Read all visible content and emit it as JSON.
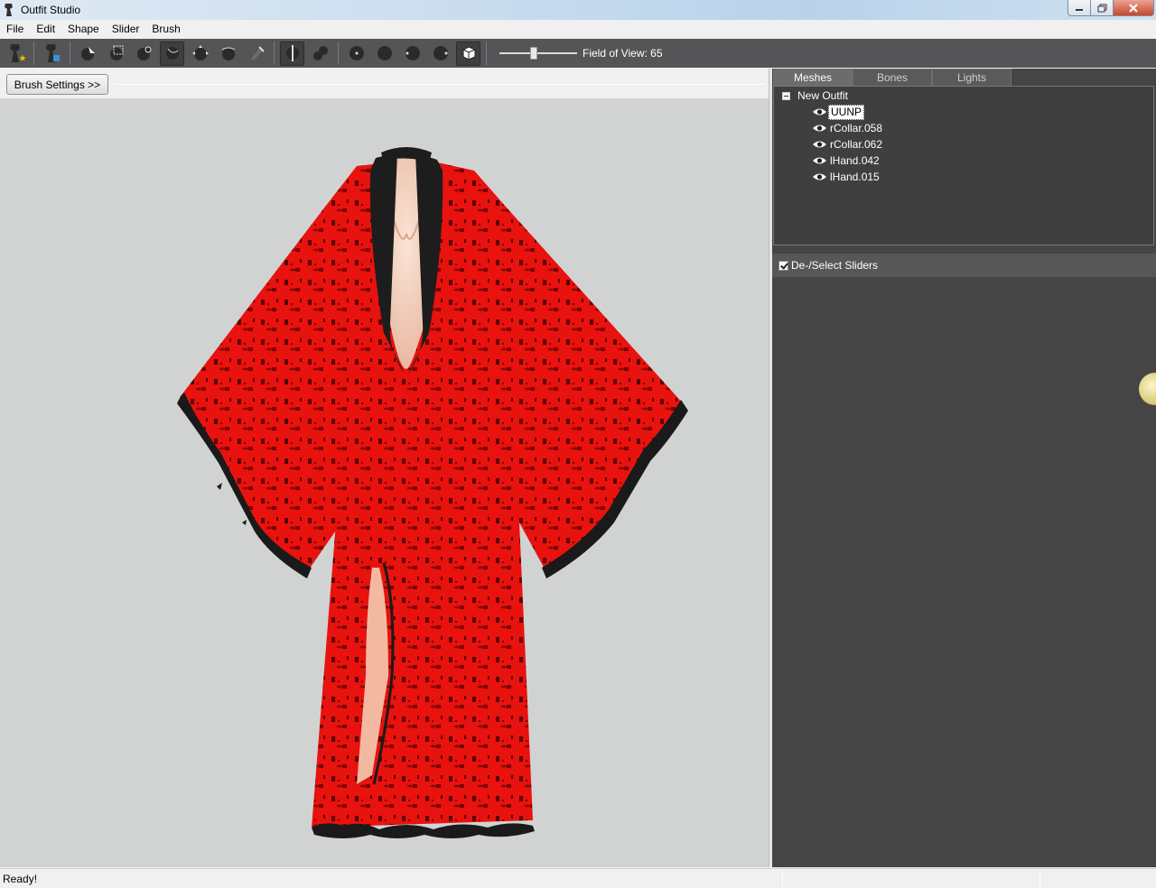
{
  "window": {
    "title": "Outfit Studio"
  },
  "menu": [
    "File",
    "Edit",
    "Shape",
    "Slider",
    "Brush"
  ],
  "toolbar": {
    "fov_label": "Field of View: 65",
    "icons": [
      "new-project-icon",
      "load-outfit-icon",
      "select-tool-icon",
      "mask-tool-icon",
      "inflate-tool-icon",
      "deflate-tool-icon",
      "move-tool-icon",
      "smooth-tool-icon",
      "weight-tool-icon",
      "x-mirror-icon",
      "connected-icon",
      "front-view-icon",
      "back-view-icon",
      "left-view-icon",
      "right-view-icon",
      "perspective-icon"
    ],
    "fov_fraction": 0.44
  },
  "brush": {
    "settings_label": "Brush Settings >>"
  },
  "panel": {
    "tabs": [
      "Meshes",
      "Bones",
      "Lights"
    ],
    "active_tab": "Meshes",
    "tree": {
      "root": "New Outfit",
      "items": [
        "UUNP",
        "rCollar.058",
        "rCollar.062",
        "lHand.042",
        "lHand.015"
      ],
      "selected": "UUNP"
    },
    "sliders_toggle": "De-/Select Sliders"
  },
  "status": {
    "text": "Ready!"
  },
  "colors": {
    "toolbar": "#555558",
    "panel": "#454545",
    "viewport": "#d1d3d3",
    "dress": "#e8120e"
  }
}
